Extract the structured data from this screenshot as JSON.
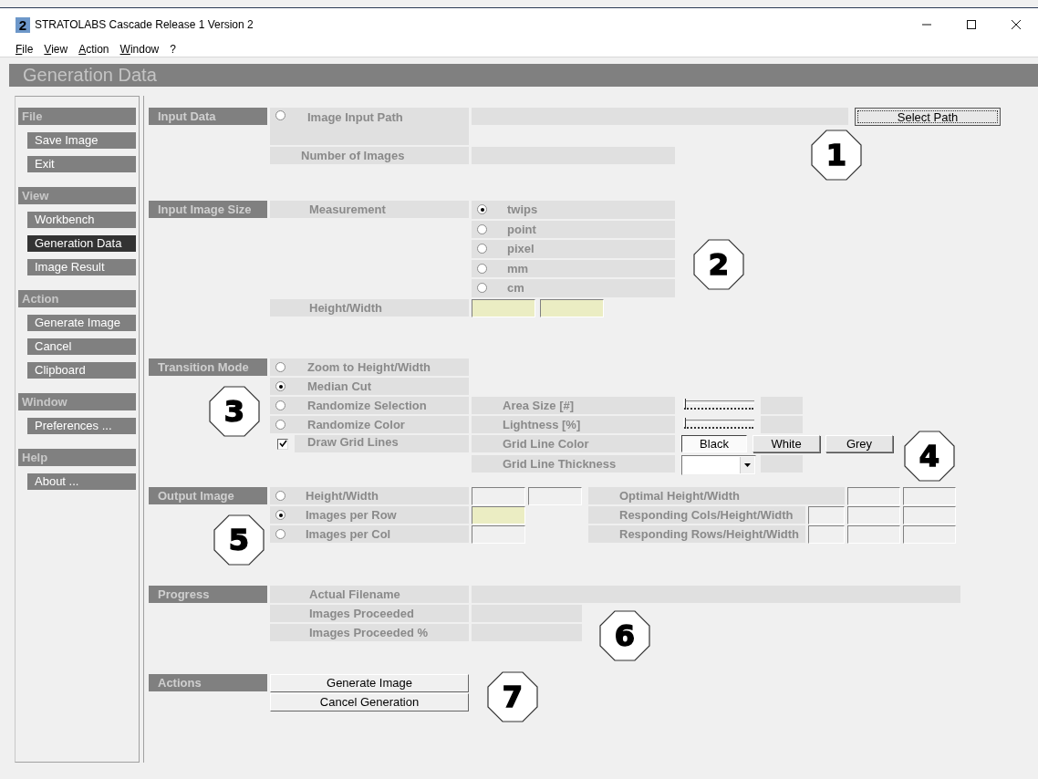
{
  "window": {
    "title": "STRATOLABS Cascade Release 1 Version 2",
    "app_icon": "2"
  },
  "menu": [
    "File",
    "View",
    "Action",
    "Window",
    "?"
  ],
  "page_title": "Generation Data",
  "sidebar": [
    {
      "heading": "File",
      "items": [
        {
          "label": "Save Image",
          "selected": false
        },
        {
          "label": "Exit",
          "selected": false
        }
      ]
    },
    {
      "heading": "View",
      "items": [
        {
          "label": "Workbench",
          "selected": false
        },
        {
          "label": "Generation Data",
          "selected": true
        },
        {
          "label": "Image Result",
          "selected": false
        }
      ]
    },
    {
      "heading": "Action",
      "items": [
        {
          "label": "Generate Image",
          "selected": false
        },
        {
          "label": "Cancel",
          "selected": false
        },
        {
          "label": "Clipboard",
          "selected": false
        }
      ]
    },
    {
      "heading": "Window",
      "items": [
        {
          "label": "Preferences ...",
          "selected": false
        }
      ]
    },
    {
      "heading": "Help",
      "items": [
        {
          "label": "About ...",
          "selected": false
        }
      ]
    }
  ],
  "input_data": {
    "label": "Input Data",
    "path_option": {
      "label": "Image Input Path",
      "selected": false
    },
    "select_path_button": "Select Path",
    "images_label": "Number of Images"
  },
  "input_image_size": {
    "label": "Input Image Size",
    "measurement_label": "Measurement",
    "units": [
      {
        "label": "twips",
        "selected": true
      },
      {
        "label": "point",
        "selected": false
      },
      {
        "label": "pixel",
        "selected": false
      },
      {
        "label": "mm",
        "selected": false
      },
      {
        "label": "cm",
        "selected": false
      }
    ],
    "height_width_label": "Height/Width"
  },
  "transition_mode": {
    "label": "Transition Mode",
    "modes": [
      {
        "label": "Zoom to Height/Width",
        "selected": false
      },
      {
        "label": "Median Cut",
        "selected": true
      },
      {
        "label": "Randomize Selection",
        "selected": false
      },
      {
        "label": "Randomize Color",
        "selected": false
      }
    ],
    "draw_grid_lines": {
      "label": "Draw Grid Lines",
      "checked": true
    },
    "area_size": {
      "label": "Area Size [#]",
      "level": 0
    },
    "lightness": {
      "label": "Lightness [%]",
      "level": 0
    },
    "grid_line_color": {
      "label": "Grid Line Color",
      "options": [
        {
          "label": "Black",
          "selected": true
        },
        {
          "label": "White",
          "selected": false
        },
        {
          "label": "Grey",
          "selected": false
        }
      ]
    },
    "grid_line_thickness_label": "Grid Line Thickness"
  },
  "output_image": {
    "label": "Output Image",
    "options": [
      {
        "label": "Height/Width",
        "selected": false
      },
      {
        "label": "Images per Row",
        "selected": true
      },
      {
        "label": "Images per Col",
        "selected": false
      }
    ],
    "result_labels": [
      "Optimal Height/Width",
      "Responding Cols/Height/Width",
      "Responding Rows/Height/Width"
    ]
  },
  "progress": {
    "label": "Progress",
    "rows": [
      "Actual Filename",
      "Images Proceeded",
      "Images Proceeded %"
    ]
  },
  "actions": {
    "label": "Actions",
    "buttons": [
      "Generate Image",
      "Cancel Generation"
    ]
  },
  "callouts": [
    "1",
    "2",
    "3",
    "4",
    "5",
    "6",
    "7"
  ]
}
